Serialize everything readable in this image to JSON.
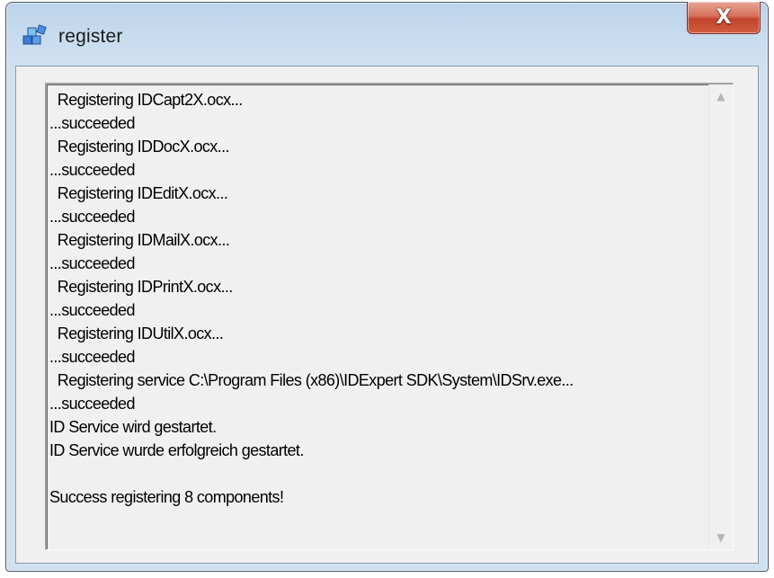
{
  "window": {
    "title": "register",
    "close_glyph": "X",
    "icon": "registry-app-icon"
  },
  "log": {
    "lines": [
      "  Registering IDCapt2X.ocx...",
      "...succeeded",
      "  Registering IDDocX.ocx...",
      "...succeeded",
      "  Registering IDEditX.ocx...",
      "...succeeded",
      "  Registering IDMailX.ocx...",
      "...succeeded",
      "  Registering IDPrintX.ocx...",
      "...succeeded",
      "  Registering IDUtilX.ocx...",
      "...succeeded",
      "  Registering service C:\\Program Files (x86)\\IDExpert SDK\\System\\IDSrv.exe...",
      "...succeeded",
      "ID Service wird gestartet.",
      "ID Service wurde erfolgreich gestartet.",
      "",
      "Success registering 8 components!"
    ]
  },
  "scrollbar": {
    "up_glyph": "▲",
    "down_glyph": "▼"
  },
  "colors": {
    "close_button": "#c3442c",
    "frame": "#cfe0f1",
    "client_background": "#f0f0f0"
  }
}
